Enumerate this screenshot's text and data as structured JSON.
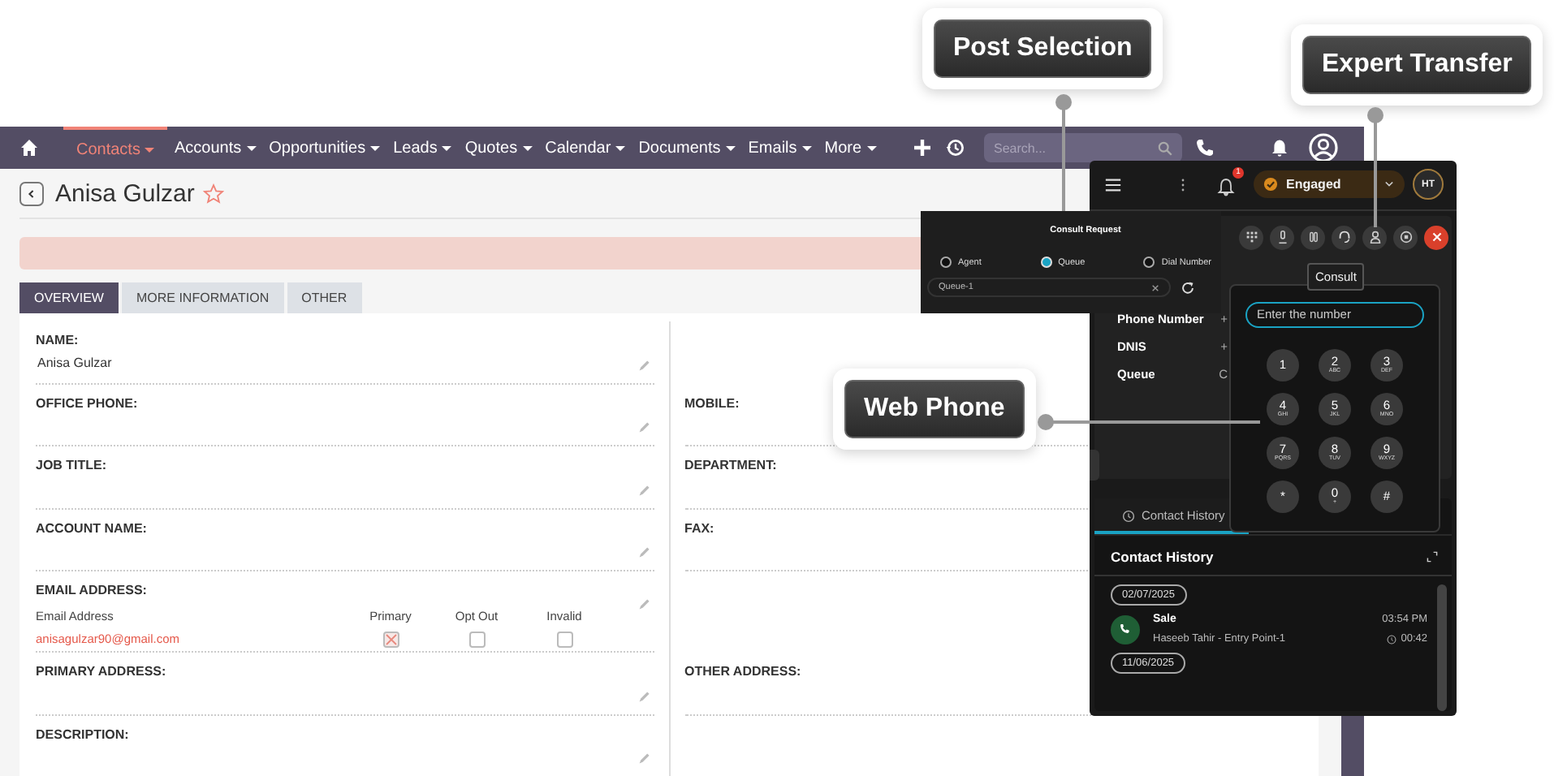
{
  "nav": {
    "items": [
      {
        "label": "Contacts",
        "selected": true
      },
      {
        "label": "Accounts",
        "selected": false
      },
      {
        "label": "Opportunities",
        "selected": false
      },
      {
        "label": "Leads",
        "selected": false
      },
      {
        "label": "Quotes",
        "selected": false
      },
      {
        "label": "Calendar",
        "selected": false
      },
      {
        "label": "Documents",
        "selected": false
      },
      {
        "label": "Emails",
        "selected": false
      },
      {
        "label": "More",
        "selected": false
      }
    ],
    "search": {
      "placeholder": "Search..."
    }
  },
  "record": {
    "title": "Anisa Gulzar",
    "favorite": false
  },
  "tabs": [
    {
      "label": "OVERVIEW",
      "selected": true
    },
    {
      "label": "MORE INFORMATION",
      "selected": false
    },
    {
      "label": "OTHER",
      "selected": false
    }
  ],
  "rows": [
    {
      "left": {
        "label": "NAME:",
        "value": "Anisa Gulzar"
      }
    },
    {
      "left": {
        "label": "OFFICE PHONE:"
      },
      "right": {
        "label": "MOBILE:"
      }
    },
    {
      "left": {
        "label": "JOB TITLE:"
      },
      "right": {
        "label": "DEPARTMENT:"
      }
    },
    {
      "left": {
        "label": "ACCOUNT NAME:"
      },
      "right": {
        "label": "FAX:"
      }
    },
    {
      "left": {
        "label": "EMAIL ADDRESS:",
        "kind": "email",
        "headers": [
          "Email Address",
          "Primary",
          "Opt Out",
          "Invalid"
        ],
        "email": "anisagulzar90@gmail.com",
        "flags": [
          {
            "checked": true
          },
          {
            "checked": false
          },
          {
            "checked": false
          }
        ]
      }
    },
    {
      "left": {
        "label": "PRIMARY ADDRESS:"
      },
      "right": {
        "label": "OTHER ADDRESS:"
      }
    },
    {
      "left": {
        "label": "DESCRIPTION:"
      }
    }
  ],
  "phone": {
    "notifications": "1",
    "status": "Engaged",
    "avatar": "HT",
    "tooltip": "Consult",
    "details": [
      {
        "label": "Phone Number",
        "value": "+"
      },
      {
        "label": "DNIS",
        "value": "+"
      },
      {
        "label": "Queue",
        "value": "C"
      }
    ],
    "dialpad": {
      "placeholder": "Enter the number",
      "keys": [
        {
          "digit": "1"
        },
        {
          "digit": "2",
          "letters": "ABC"
        },
        {
          "digit": "3",
          "letters": "DEF"
        },
        {
          "digit": "4",
          "letters": "GHI"
        },
        {
          "digit": "5",
          "letters": "JKL"
        },
        {
          "digit": "6",
          "letters": "MNO"
        },
        {
          "digit": "7",
          "letters": "PQRS"
        },
        {
          "digit": "8",
          "letters": "TUV"
        },
        {
          "digit": "9",
          "letters": "WXYZ"
        },
        {
          "digit": "*"
        },
        {
          "digit": "0",
          "letters": "+"
        },
        {
          "digit": "#"
        }
      ]
    },
    "history": {
      "tab": "Contact History",
      "title": "Contact History",
      "groups": [
        {
          "date": "02/07/2025",
          "entries": [
            {
              "title": "Sale",
              "subtitle": "Haseeb Tahir - Entry Point-1",
              "time": "03:54 PM",
              "duration": "00:42"
            }
          ]
        },
        {
          "date": "11/06/2025"
        }
      ]
    }
  },
  "consult": {
    "title": "Consult Request",
    "options": [
      {
        "label": "Agent",
        "selected": false
      },
      {
        "label": "Queue",
        "selected": true
      },
      {
        "label": "Dial Number",
        "selected": false
      }
    ],
    "queue": "Queue-1"
  },
  "callouts": [
    {
      "label": "Post Selection"
    },
    {
      "label": "Expert Transfer"
    },
    {
      "label": "Web Phone"
    }
  ]
}
